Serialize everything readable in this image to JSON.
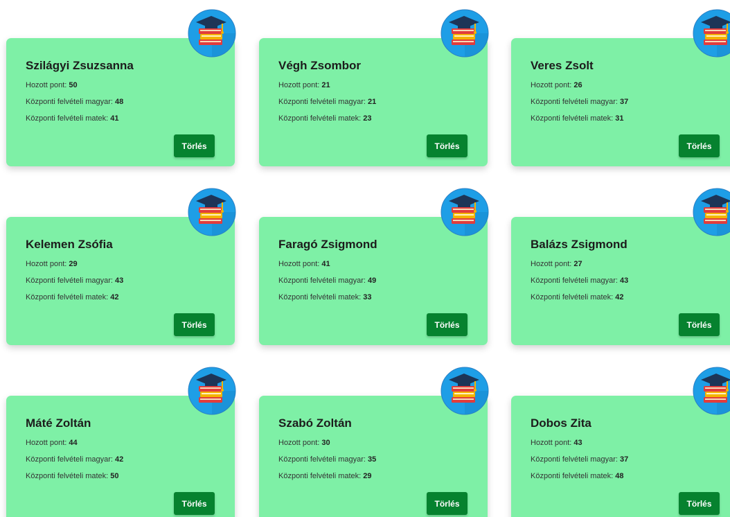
{
  "labels": {
    "hozott": "Hozott pont:",
    "magyar": "Központi felvételi magyar:",
    "matek": "Központi felvételi matek:",
    "delete": "Törlés"
  },
  "students": [
    {
      "name": "Szilágyi Zsuzsanna",
      "hozott": "50",
      "magyar": "48",
      "matek": "41"
    },
    {
      "name": "Végh Zsombor",
      "hozott": "21",
      "magyar": "21",
      "matek": "23"
    },
    {
      "name": "Veres Zsolt",
      "hozott": "26",
      "magyar": "37",
      "matek": "31"
    },
    {
      "name": "Kelemen Zsófia",
      "hozott": "29",
      "magyar": "43",
      "matek": "42"
    },
    {
      "name": "Faragó Zsigmond",
      "hozott": "41",
      "magyar": "49",
      "matek": "33"
    },
    {
      "name": "Balázs Zsigmond",
      "hozott": "27",
      "magyar": "43",
      "matek": "42"
    },
    {
      "name": "Máté Zoltán",
      "hozott": "44",
      "magyar": "42",
      "matek": "50"
    },
    {
      "name": "Szabó Zoltán",
      "hozott": "30",
      "magyar": "35",
      "matek": "29"
    },
    {
      "name": "Dobos Zita",
      "hozott": "43",
      "magyar": "37",
      "matek": "48"
    }
  ],
  "icons": {
    "badge": "graduation-books-icon"
  },
  "colors": {
    "card_bg": "#7ef0a6",
    "button_bg": "#06822f",
    "badge_bg": "#1e9ee6"
  }
}
